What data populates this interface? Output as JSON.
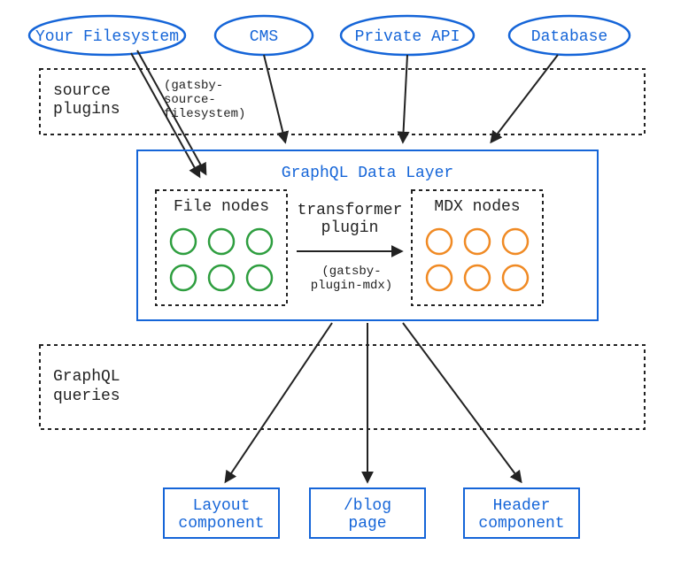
{
  "sources": {
    "filesystem": "Your Filesystem",
    "cms": "CMS",
    "private_api": "Private API",
    "database": "Database"
  },
  "source_plugins": {
    "label_line1": "source",
    "label_line2": "plugins",
    "example_line1": "(gatsby-",
    "example_line2": "source-",
    "example_line3": "filesystem)"
  },
  "data_layer": {
    "title": "GraphQL Data Layer",
    "file_nodes": "File nodes",
    "mdx_nodes": "MDX nodes",
    "transformer_line1": "transformer",
    "transformer_line2": "plugin",
    "example_line1": "(gatsby-",
    "example_line2": "plugin-mdx)"
  },
  "queries": {
    "label_line1": "GraphQL",
    "label_line2": "queries"
  },
  "components": {
    "layout_line1": "Layout",
    "layout_line2": "component",
    "blog_line1": "/blog",
    "blog_line2": "page",
    "header_line1": "Header",
    "header_line2": "component"
  },
  "colors": {
    "blue": "#1565d8",
    "green": "#2e9e3f",
    "orange": "#f08a24"
  }
}
